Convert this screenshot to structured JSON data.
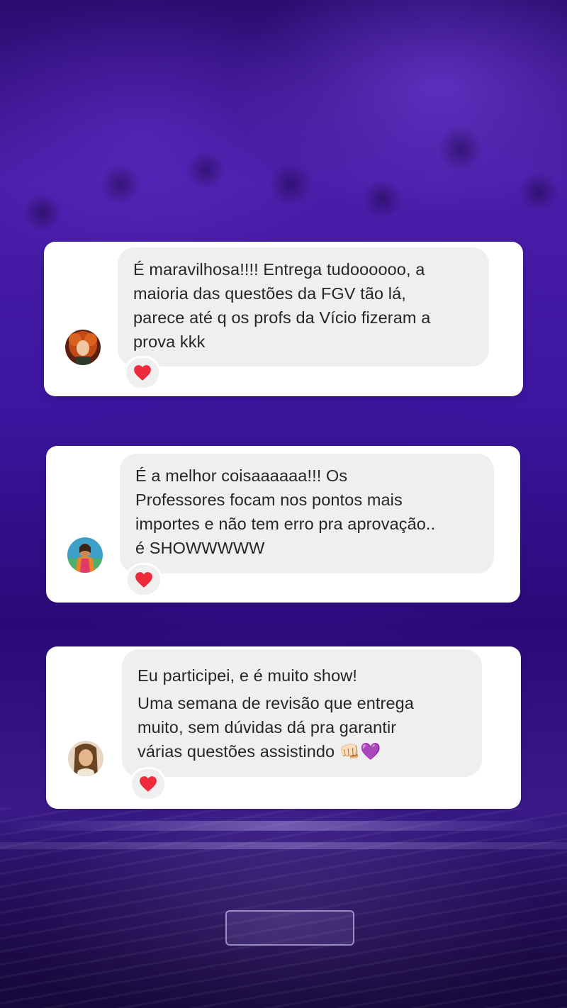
{
  "comments": [
    {
      "lines": [
        "É maravilhosa!!!! Entrega tudoooooo, a",
        "maioria das questões da FGV tão lá,",
        "parece até q os profs da Vício fizeram a",
        "prova kkk"
      ],
      "reaction": "heart-icon"
    },
    {
      "lines": [
        "É a melhor coisaaaaaa!!! Os",
        "Professores focam nos pontos mais",
        "importes e não tem erro pra aprovação..",
        "é SHOWWWWW"
      ],
      "reaction": "heart-icon"
    },
    {
      "lines": [
        "Eu participei, e é muito show!",
        "Uma semana de revisão que entrega",
        "muito, sem dúvidas dá pra garantir",
        "várias questões assistindo 👊🏻💜"
      ],
      "reaction": "heart-icon"
    }
  ],
  "colors": {
    "card": "#ffffff",
    "bubble": "#efefef",
    "text": "#262626",
    "heart": "#ed2b3c",
    "background": "#3c15a0"
  }
}
